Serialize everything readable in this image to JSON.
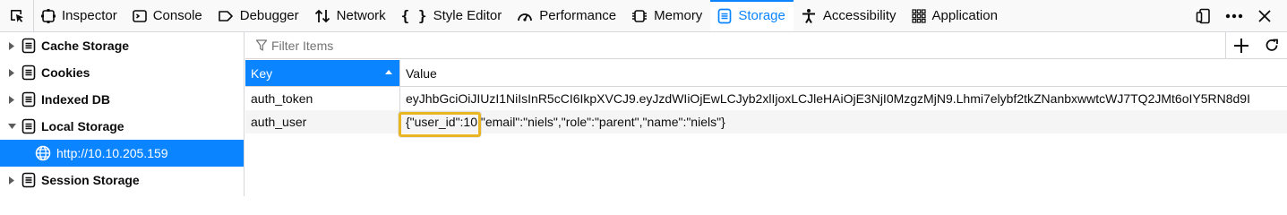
{
  "toolbar": {
    "tabs": [
      {
        "label": "Inspector",
        "icon": "inspector-icon"
      },
      {
        "label": "Console",
        "icon": "console-icon"
      },
      {
        "label": "Debugger",
        "icon": "debugger-icon"
      },
      {
        "label": "Network",
        "icon": "network-icon"
      },
      {
        "label": "Style Editor",
        "icon": "style-editor-icon"
      },
      {
        "label": "Performance",
        "icon": "performance-icon"
      },
      {
        "label": "Memory",
        "icon": "memory-icon"
      },
      {
        "label": "Storage",
        "icon": "storage-icon",
        "active": true
      },
      {
        "label": "Accessibility",
        "icon": "accessibility-icon"
      },
      {
        "label": "Application",
        "icon": "application-icon"
      }
    ]
  },
  "sidebar": {
    "items": [
      {
        "label": "Cache Storage",
        "expanded": false
      },
      {
        "label": "Cookies",
        "expanded": false
      },
      {
        "label": "Indexed DB",
        "expanded": false
      },
      {
        "label": "Local Storage",
        "expanded": true
      },
      {
        "label": "http://10.10.205.159",
        "selected": true
      },
      {
        "label": "Session Storage",
        "expanded": false
      }
    ]
  },
  "filter": {
    "placeholder": "Filter Items"
  },
  "table": {
    "columns": [
      "Key",
      "Value"
    ],
    "rows": [
      {
        "key": "auth_token",
        "value": "eyJhbGciOiJIUzI1NiIsInR5cCI6IkpXVCJ9.eyJzdWIiOjEwLCJyb2xlIjoxLCJleHAiOjE3NjI0MzgzMjN9.Lhmi7elybf2tkZNanbxwwtcWJ7TQ2JMt6oIY5RN8d9I"
      },
      {
        "key": "auth_user",
        "value": "{\"user_id\":10,\"email\":\"niels\",\"role\":\"parent\",\"name\":\"niels\"}"
      }
    ]
  },
  "colors": {
    "accent": "#0a84ff",
    "highlight": "#e8b623"
  }
}
